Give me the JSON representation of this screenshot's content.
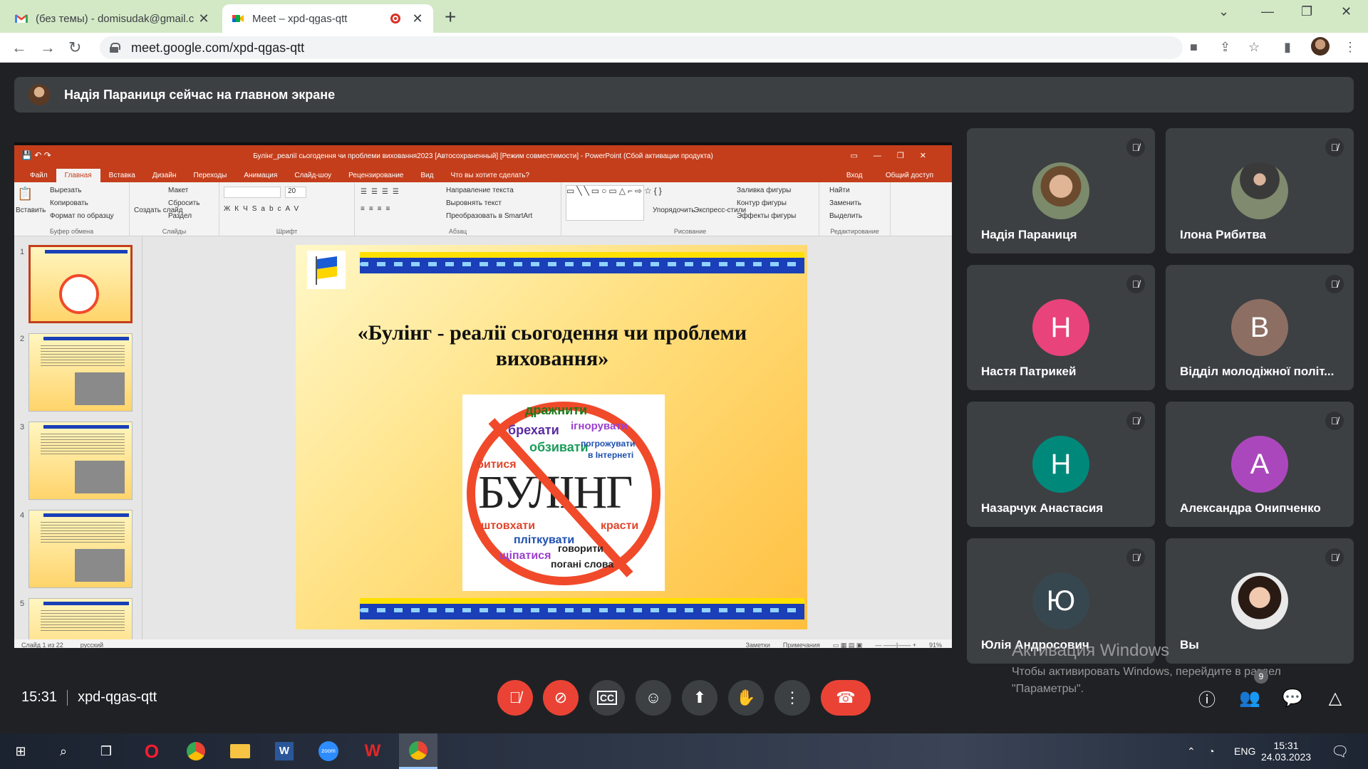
{
  "browser": {
    "tabs": [
      {
        "title": "(без темы) - domisudak@gmail.c",
        "active": false
      },
      {
        "title": "Meet – xpd-qgas-qtt",
        "active": true
      }
    ],
    "url": "meet.google.com/xpd-qgas-qtt"
  },
  "meet": {
    "banner": "Надія Параниця сейчас на главном экране",
    "time": "15:31",
    "code": "xpd-qgas-qtt",
    "people_badge": "9",
    "participants": [
      {
        "name": "Надія Параниця",
        "type": "photo"
      },
      {
        "name": "Ілона Рибитва",
        "type": "photo"
      },
      {
        "name": "Настя Патрикей",
        "letter": "Н",
        "color": "#e8437a"
      },
      {
        "name": "Відділ молодіжної політ...",
        "letter": "В",
        "color": "#8d6e63"
      },
      {
        "name": "Назарчук Анастасия",
        "letter": "Н",
        "color": "#00897b"
      },
      {
        "name": "Александра Онипченко",
        "letter": "А",
        "color": "#ab47bc"
      },
      {
        "name": "Юлія Андросович",
        "letter": "Ю",
        "color": "#37474f"
      },
      {
        "name": "Вы",
        "type": "photo"
      }
    ]
  },
  "powerpoint": {
    "window_title": "Булінг_реалії сьогодення чи проблеми виховання2023 [Автосохраненный] [Режим совместимости] - PowerPoint (Сбой активации продукта)",
    "tabs": [
      "Файл",
      "Главная",
      "Вставка",
      "Дизайн",
      "Переходы",
      "Анимация",
      "Слайд-шоу",
      "Рецензирование",
      "Вид",
      "Что вы хотите сделать?"
    ],
    "tabs_right": [
      "Вход",
      "Общий доступ"
    ],
    "ribbon": {
      "paste": "Вставить",
      "cut": "Вырезать",
      "copy": "Копировать",
      "format": "Формат по образцу",
      "clipboard": "Буфер обмена",
      "new_slide": "Создать слайд",
      "layout": "Макет",
      "reset": "Сбросить",
      "section": "Раздел",
      "slides": "Слайды",
      "font_size": "20",
      "font": "Шрифт",
      "text_dir": "Направление текста",
      "align_text": "Выровнять текст",
      "smartart": "Преобразовать в SmartArt",
      "paragraph": "Абзац",
      "arrange": "Упорядочить",
      "styles": "Экспресс-стили",
      "fill": "Заливка фигуры",
      "outline": "Контур фигуры",
      "effects": "Эффекты фигуры",
      "drawing": "Рисование",
      "find": "Найти",
      "replace": "Заменить",
      "select": "Выделить",
      "editing": "Редактирование"
    },
    "thumb_numbers": [
      "1",
      "2",
      "3",
      "4",
      "5"
    ],
    "slide": {
      "title": "«Булінг - реалії сьогодення чи проблеми виховання»",
      "poster_big": "БУЛІНГ",
      "poster_words": [
        "дражнити",
        "брехати",
        "ігнорувати",
        "обзивати",
        "погрожувати",
        "в Інтернеті",
        "битися",
        "штовхати",
        "красти",
        "пліткувати",
        "говорити",
        "щіпатися",
        "погані слова"
      ]
    },
    "status": {
      "slide_no": "Слайд 1 из 22",
      "lang": "русский",
      "notes": "Заметки",
      "comments": "Примечания",
      "zoom": "91%"
    }
  },
  "windows": {
    "activate_title": "Активация Windows",
    "activate_text1": "Чтобы активировать Windows, перейдите в раздел",
    "activate_text2": "\"Параметры\".",
    "lang": "ENG",
    "clock_time": "15:31",
    "clock_date": "24.03.2023"
  }
}
